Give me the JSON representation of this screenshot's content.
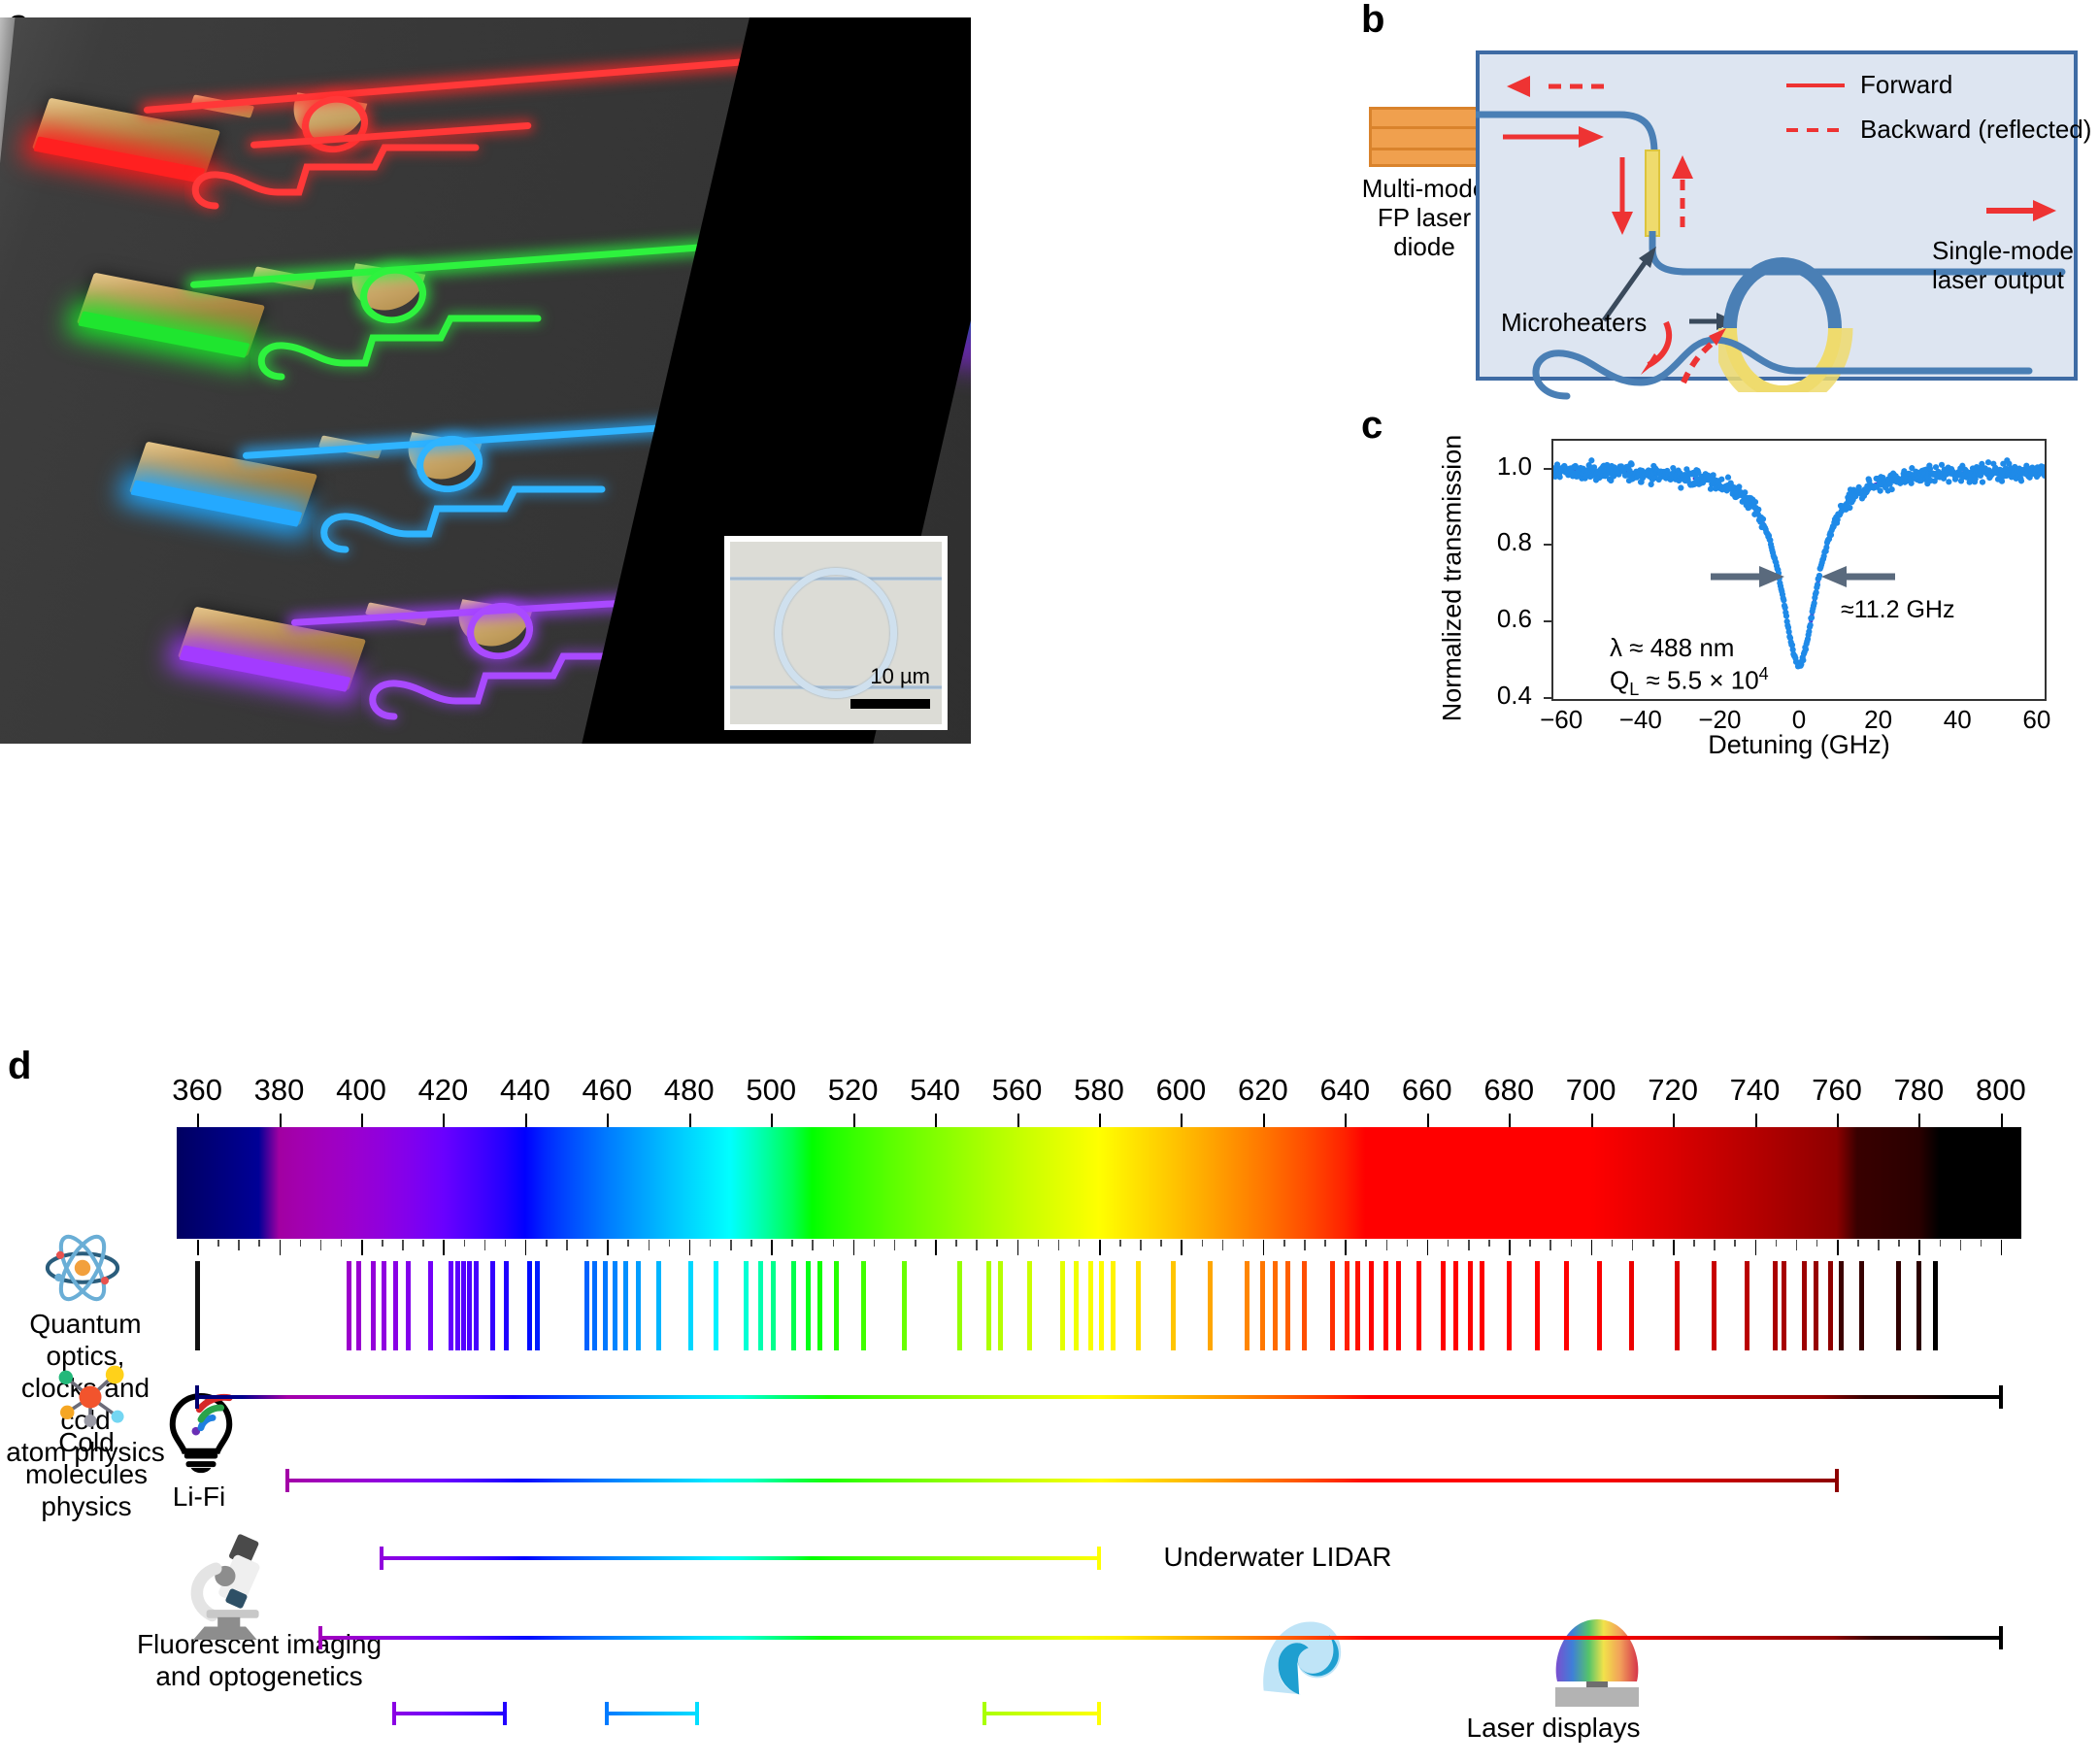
{
  "panels": {
    "a": {
      "letter": "a"
    },
    "b": {
      "letter": "b"
    },
    "c": {
      "letter": "c"
    },
    "d": {
      "letter": "d"
    }
  },
  "panel_a": {
    "sem_inset": {
      "scale_label": "10 µm"
    },
    "laser_colors": [
      "#ff2b2b",
      "#2dff4a",
      "#2bb8ff",
      "#a64bff"
    ]
  },
  "panel_b": {
    "diode_label": "Multi-mode\nFP laser\ndiode",
    "diode_label_lines": [
      "Multi-mode",
      "FP laser",
      "diode"
    ],
    "legend": [
      {
        "label": "Forward",
        "style": "solid",
        "color": "#ee3333"
      },
      {
        "label": "Backward (reflected)",
        "style": "dashed",
        "color": "#ee3333"
      }
    ],
    "microheaters_label": "Microheaters",
    "output_label_lines": [
      "Single-mode",
      "laser output"
    ],
    "box_fill": "#dde5f1",
    "box_stroke": "#3e6ba4",
    "waveguide_color": "#4a7fb5",
    "heater_color": "#efdb6d"
  },
  "chart_data": {
    "type": "scatter",
    "title": "",
    "xlabel": "Detuning (GHz)",
    "ylabel": "Normalized transmission",
    "xlim": [
      -62,
      62
    ],
    "ylim": [
      0.4,
      1.075
    ],
    "xticks": [
      -60,
      -40,
      -20,
      0,
      20,
      40,
      60
    ],
    "xtick_labels": [
      "−60",
      "−40",
      "−20",
      "0",
      "20",
      "40",
      "60"
    ],
    "yticks": [
      0.4,
      0.6,
      0.8,
      1.0
    ],
    "ytick_labels": [
      "0.4",
      "0.6",
      "0.8",
      "1.0"
    ],
    "grid": false,
    "legend": "none",
    "marker_color": "#1f8ae8",
    "fit_color": "#4b2fd0",
    "annotations": [
      {
        "text": "≈11.2 GHz",
        "x": 14,
        "y": 0.7
      },
      {
        "text": "λ ≈ 488 nm",
        "x": -38,
        "y": 0.575
      },
      {
        "text": "Q_L ≈ 5.5 × 10^4",
        "x": -38,
        "y": 0.525
      }
    ],
    "annotation_lambda": "λ ≈ 488 nm",
    "annotation_q_prefix": "Q",
    "annotation_q_sub": "L",
    "annotation_q_rest": " ≈ 5.5 × 10",
    "annotation_q_exp": "4",
    "annotation_linewidth": "≈11.2 GHz",
    "linewidth_ghz": 11.2,
    "resonance_wavelength_nm": 488,
    "loaded_q": 55000,
    "baseline": 1.0,
    "depth_min": 0.49,
    "fwhm_ghz": 11.2,
    "noise_sigma": 0.018,
    "n_points": 760
  },
  "panel_d": {
    "axis": {
      "label_unit": "nm",
      "min": 355,
      "max": 805,
      "ticks": [
        360,
        380,
        400,
        420,
        440,
        460,
        480,
        500,
        520,
        540,
        560,
        580,
        600,
        620,
        640,
        660,
        680,
        700,
        720,
        740,
        760,
        780,
        800
      ]
    },
    "categories": [
      {
        "name": "Quantum optics, clocks and cold atom physics",
        "lines": [
          "Quantum optics,",
          "clocks and cold",
          "atom physics"
        ],
        "icon": "atom-icon"
      },
      {
        "name": "Cold molecules physics",
        "lines": [
          "Cold",
          "molecules",
          "physics"
        ],
        "icon": "molecule-icon"
      },
      {
        "name": "Li-Fi",
        "lines": [
          "Li-Fi"
        ],
        "icon": "lightbulb-wifi-icon"
      },
      {
        "name": "Underwater LIDAR",
        "lines": [
          "Underwater LIDAR"
        ],
        "icon": "wave-icon"
      },
      {
        "name": "Fluorescent imaging and optogenetics",
        "lines": [
          "Fluorescent imaging",
          "and optogenetics"
        ],
        "icon": "microscope-icon"
      },
      {
        "name": "Laser displays",
        "lines": [
          "Laser displays"
        ],
        "icon": "laser-display-icon"
      }
    ],
    "atomic_lines_nm": [
      360.0,
      397.0,
      399.5,
      403.0,
      405.5,
      408.5,
      411.5,
      417.0,
      422.0,
      423.5,
      425.0,
      426.5,
      428.0,
      432.0,
      435.5,
      441.0,
      443.0,
      455.0,
      457.0,
      459.5,
      462.0,
      464.5,
      467.5,
      472.5,
      480.5,
      486.5,
      494.0,
      497.5,
      500.5,
      505.5,
      509.0,
      512.0,
      516.0,
      522.5,
      532.5,
      546.0,
      553.0,
      556.0,
      563.0,
      571.0,
      574.5,
      578.0,
      580.5,
      583.5,
      589.5,
      598.0,
      607.0,
      616.0,
      620.0,
      623.0,
      626.0,
      630.0,
      637.0,
      640.5,
      643.0,
      646.5,
      650.0,
      653.0,
      658.0,
      664.0,
      667.0,
      670.5,
      673.5,
      680.0,
      687.0,
      694.0,
      702.0,
      710.0,
      721.0,
      730.0,
      738.0,
      745.0,
      747.0,
      752.0,
      755.0,
      758.5,
      761.0,
      766.0,
      775.0,
      780.0,
      784.0
    ],
    "ranges": [
      {
        "category": "Cold molecules physics",
        "start_nm": 360,
        "end_nm": 800,
        "row": 0,
        "caps": "both"
      },
      {
        "category": "Li-Fi",
        "start_nm": 382,
        "end_nm": 760,
        "row": 1,
        "caps": "both"
      },
      {
        "category": "Underwater LIDAR",
        "start_nm": 405,
        "end_nm": 580,
        "row": 2,
        "caps": "both"
      },
      {
        "category": "Fluorescent imaging and optogenetics",
        "start_nm": 390,
        "end_nm": 800,
        "row": 3,
        "caps": "both"
      },
      {
        "category": "Fluorescent imaging blue band",
        "start_nm": 408,
        "end_nm": 435,
        "row": 4,
        "caps": "both"
      },
      {
        "category": "Fluorescent imaging green band",
        "start_nm": 460,
        "end_nm": 482,
        "row": 4,
        "caps": "both"
      },
      {
        "category": "Laser displays red band",
        "start_nm": 552,
        "end_nm": 580,
        "row": 4,
        "caps": "both"
      }
    ]
  }
}
